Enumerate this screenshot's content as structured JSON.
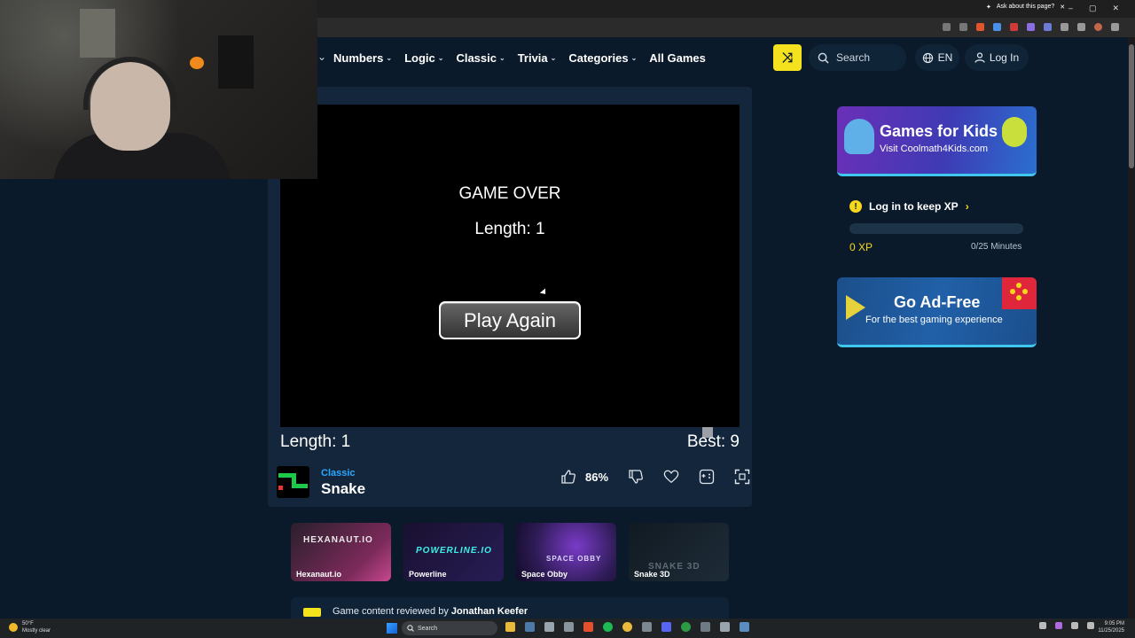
{
  "browser": {
    "ask_label": "Ask about this page?",
    "window_controls": [
      "–",
      "▢",
      "✕"
    ]
  },
  "nav": {
    "items": [
      {
        "label": "Numbers",
        "has_menu": true
      },
      {
        "label": "Logic",
        "has_menu": true
      },
      {
        "label": "Classic",
        "has_menu": true
      },
      {
        "label": "Trivia",
        "has_menu": true
      },
      {
        "label": "Categories",
        "has_menu": true
      },
      {
        "label": "All Games",
        "has_menu": false
      }
    ],
    "shuffle_icon": "⤨",
    "search_placeholder": "Search",
    "language": "EN",
    "login_label": "Log In",
    "accent_color": "#f5e21e"
  },
  "game": {
    "over_title": "GAME OVER",
    "over_length": "Length: 1",
    "play_again_label": "Play Again",
    "length_label": "Length: 1",
    "best_label": "Best: 9",
    "category": "Classic",
    "title": "Snake",
    "rating": "86%"
  },
  "related": [
    {
      "label": "Hexanaut.io",
      "art": "HEXANAUT.IO"
    },
    {
      "label": "Powerline",
      "art": "POWERLINE.IO"
    },
    {
      "label": "Space Obby",
      "art": "SPACE OBBY"
    },
    {
      "label": "Snake 3D",
      "art": "SNAKE 3D"
    }
  ],
  "reviewed": {
    "prefix": "Game content reviewed by",
    "name": "Jonathan Keefer"
  },
  "sidebar": {
    "kids_ad_title": "Games for Kids",
    "kids_ad_sub": "Visit Coolmath4Kids.com",
    "xp_login": "Log in to keep XP",
    "xp_value": "0 XP",
    "xp_minutes": "0/25 Minutes",
    "xp_progress": 0,
    "adfree_title": "Go Ad-Free",
    "adfree_sub": "For the best gaming experience"
  },
  "taskbar": {
    "weather_temp": "50°F",
    "weather_desc": "Mostly clear",
    "search_label": "Search",
    "time": "9:05 PM",
    "date": "11/25/2025"
  }
}
